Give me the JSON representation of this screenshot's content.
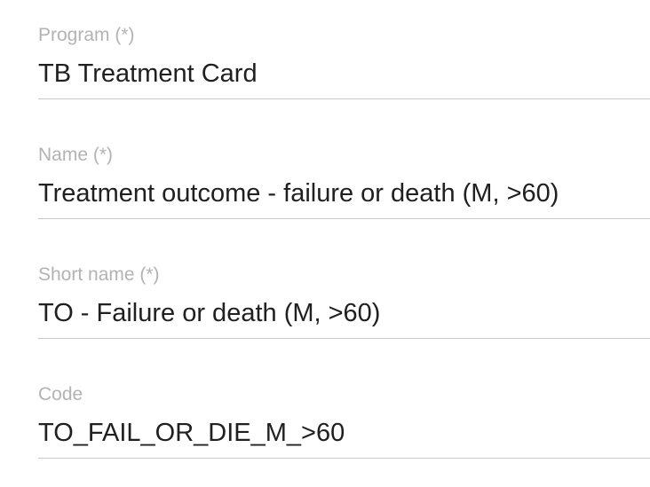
{
  "form": {
    "fields": [
      {
        "label": "Program (*)",
        "value": "TB Treatment Card"
      },
      {
        "label": "Name (*)",
        "value": "Treatment outcome - failure or death (M, >60)"
      },
      {
        "label": "Short name (*)",
        "value": "TO - Failure or death (M, >60)"
      },
      {
        "label": "Code",
        "value": "TO_FAIL_OR_DIE_M_>60"
      }
    ]
  }
}
